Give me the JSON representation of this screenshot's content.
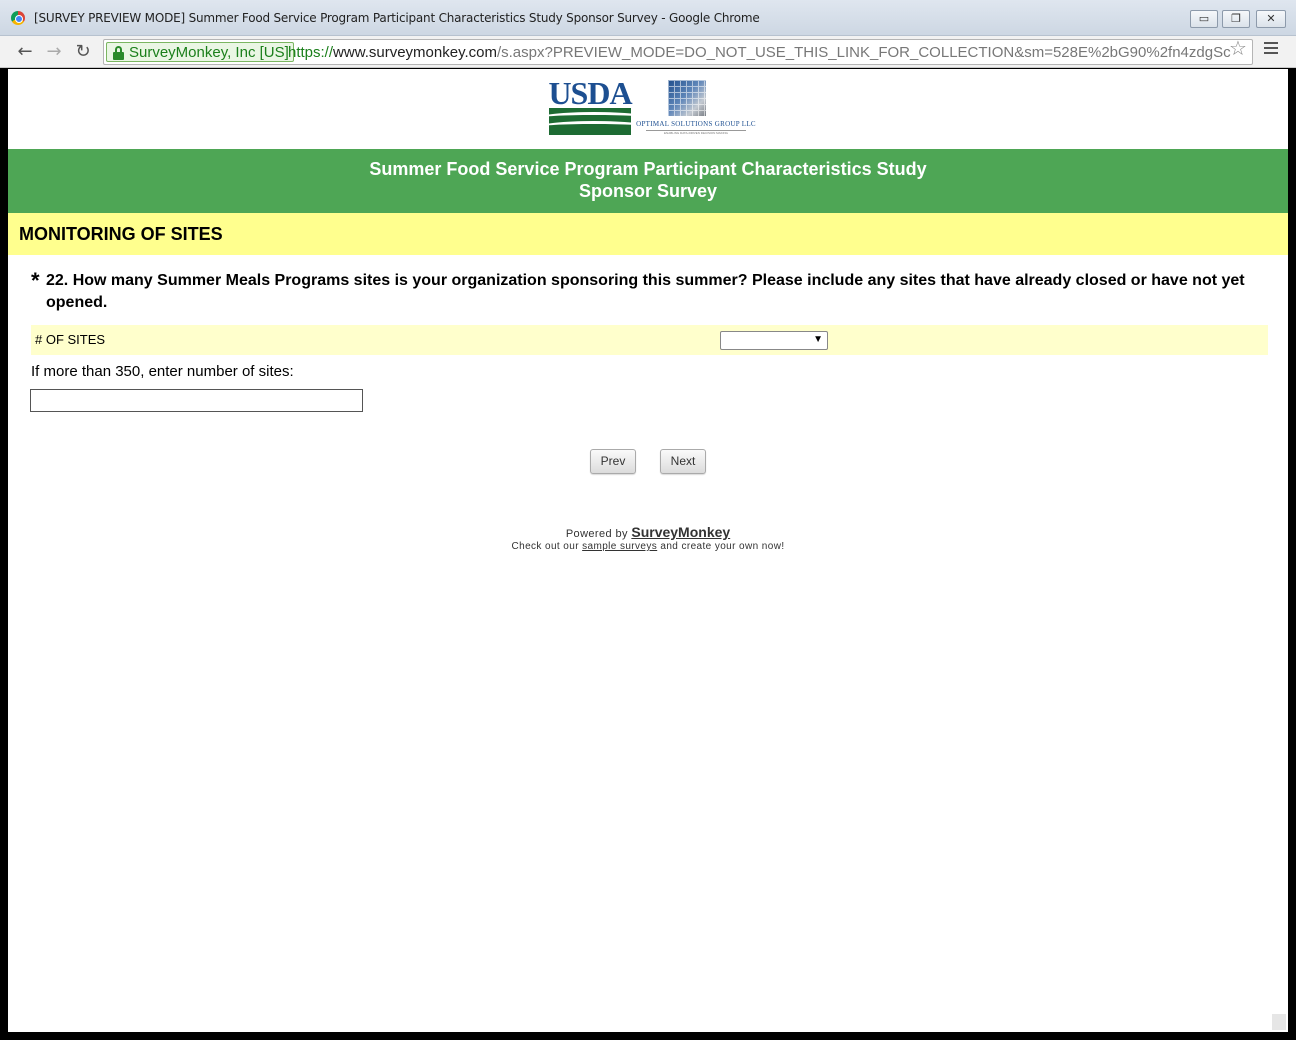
{
  "window": {
    "title": "[SURVEY PREVIEW MODE] Summer Food Service Program Participant Characteristics Study Sponsor Survey - Google Chrome",
    "minimize_glyph": "▭",
    "maximize_glyph": "❐",
    "close_glyph": "✕"
  },
  "toolbar": {
    "back_glyph": "←",
    "forward_glyph": "→",
    "reload_glyph": "↻",
    "ev_label": "SurveyMonkey, Inc [US]",
    "url_scheme": "https://",
    "url_host": "www.surveymonkey.com",
    "url_path": "/s.aspx?PREVIEW_MODE=DO_NOT_USE_THIS_LINK_FOR_COLLECTION&sm=528E%2bG90%2fn4zdgSc",
    "star_glyph": "☆"
  },
  "logos": {
    "usda_text": "USDA",
    "osg_name": "OPTIMAL SOLUTIONS GROUP LLC",
    "osg_tagline": "ENABLING DATA-DRIVEN DECISION MAKING"
  },
  "banner": {
    "line1": "Summer Food Service Program Participant Characteristics Study",
    "line2": "Sponsor Survey"
  },
  "section": {
    "title": "MONITORING OF SITES"
  },
  "question": {
    "required_marker": "*",
    "text": "22. How many Summer Meals Programs sites is your organization sponsoring this summer? Please include any sites that have already closed or have not yet opened.",
    "row_label": "# OF SITES",
    "select_value": "",
    "select_arrow": "▼",
    "other_label": "If more than 350, enter number of sites:",
    "other_value": ""
  },
  "nav": {
    "prev_label": "Prev",
    "next_label": "Next"
  },
  "footer": {
    "powered_prefix": "Powered by ",
    "powered_brand": "SurveyMonkey",
    "checkout_prefix": "Check out our ",
    "checkout_link": "sample surveys",
    "checkout_suffix": " and create your own now!"
  },
  "colors": {
    "banner_green": "#4ea655",
    "section_yellow": "#ffff8e",
    "row_yellow": "#ffffcc",
    "usda_blue": "#1d4f91",
    "ev_green": "#1b7f1b"
  }
}
